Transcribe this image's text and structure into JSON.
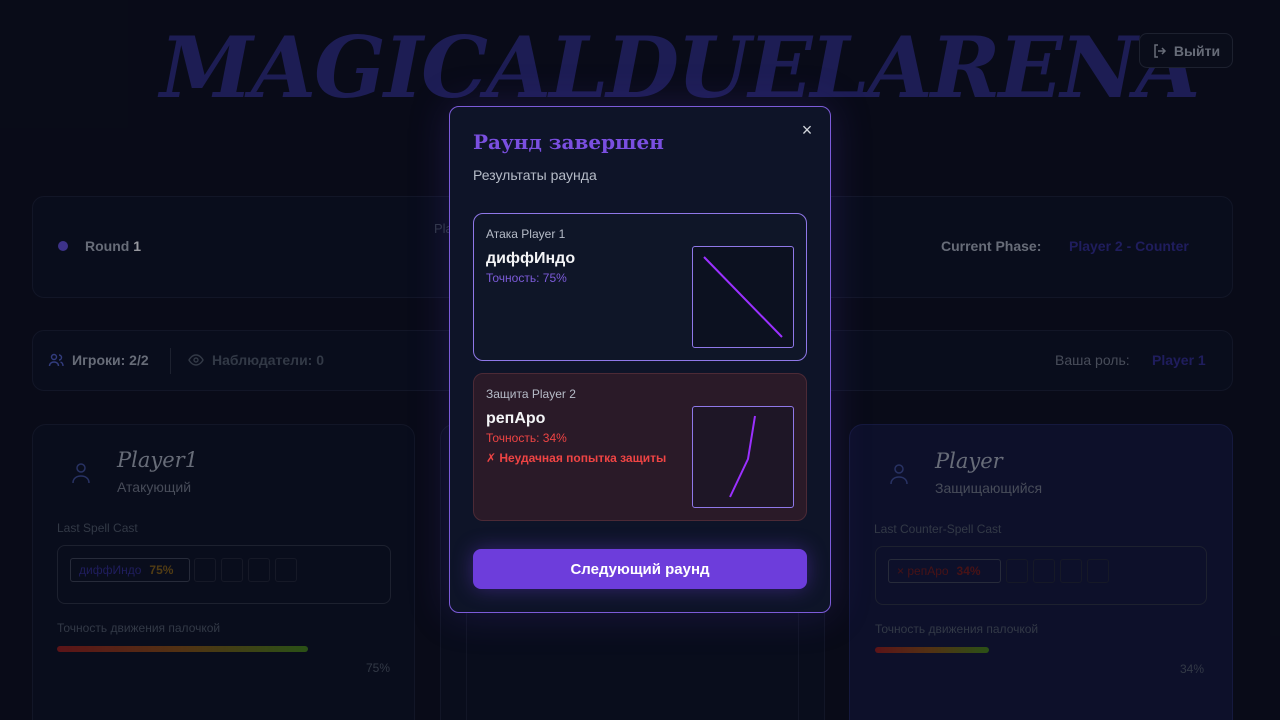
{
  "app": {
    "title": "MAGICALDUELARENA",
    "logout_label": "Выйти"
  },
  "round_bar": {
    "round_label": "Round",
    "round_number": "1",
    "player_stub": "Pla",
    "phase_label": "Current Phase:",
    "phase_value": "Player 2 - Counter"
  },
  "players_bar": {
    "players_label": "Игроки: 2/2",
    "spectators_label": "Наблюдатели: 0",
    "role_label": "Ваша роль:",
    "role_value": "Player 1"
  },
  "left_card": {
    "name": "Player1",
    "role": "Атакующий",
    "last_spell_label": "Last Spell Cast",
    "chip_spell": "диффИндо",
    "chip_acc": "75%",
    "accuracy_label": "Точность движения палочкой",
    "accuracy_value": 0.75,
    "accuracy_text": "75%"
  },
  "right_card": {
    "name": "Player",
    "role": "Защищающийся",
    "last_spell_label": "Last Counter-Spell Cast",
    "chip_spell": "× репАро",
    "chip_acc": "34%",
    "accuracy_label": "Точность движения палочкой",
    "accuracy_value": 0.34,
    "accuracy_text": "34%"
  },
  "modal": {
    "title": "Раунд завершен",
    "subtitle": "Результаты раунда",
    "close_glyph": "×",
    "attack": {
      "label": "Атака Player 1",
      "spell": "диффИндо",
      "accuracy": "Точность: 75%"
    },
    "defense": {
      "label": "Защита Player 2",
      "spell": "репАро",
      "accuracy": "Точность: 34%",
      "fail_message": "✗ Неудачная попытка защиты"
    },
    "next_button": "Следующий раунд"
  },
  "colors": {
    "accent": "#6d3ddb",
    "title_purple": "#7a4fe0",
    "error": "#ef4444",
    "trace": "#9b30ff"
  }
}
